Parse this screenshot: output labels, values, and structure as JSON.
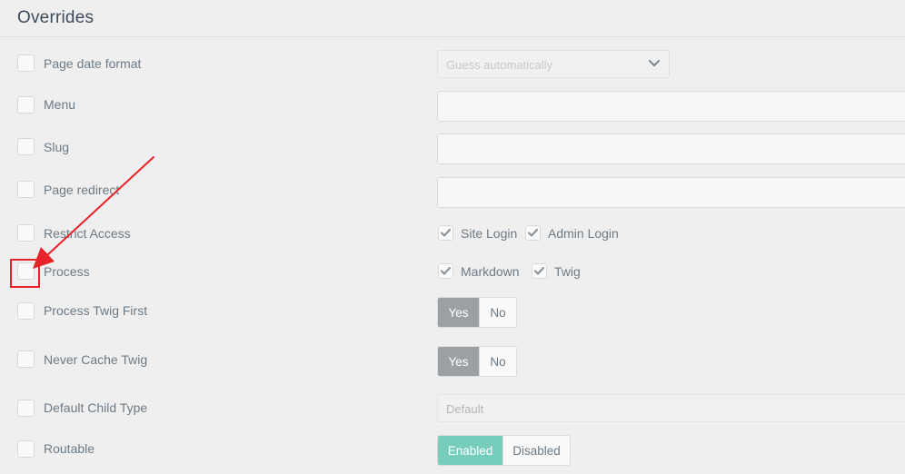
{
  "section": {
    "title": "Overrides"
  },
  "rows": {
    "page_date_format": {
      "label": "Page date format",
      "select_value": "Guess automatically"
    },
    "menu": {
      "label": "Menu",
      "value": ""
    },
    "slug": {
      "label": "Slug",
      "value": ""
    },
    "page_redirect": {
      "label": "Page redirect",
      "value": ""
    },
    "restrict_access": {
      "label": "Restrict Access",
      "options": [
        {
          "label": "Site Login",
          "checked": true
        },
        {
          "label": "Admin Login",
          "checked": true
        }
      ]
    },
    "process": {
      "label": "Process",
      "options": [
        {
          "label": "Markdown",
          "checked": true
        },
        {
          "label": "Twig",
          "checked": true
        }
      ]
    },
    "process_twig_first": {
      "label": "Process Twig First",
      "yes": "Yes",
      "no": "No",
      "selected": "Yes"
    },
    "never_cache_twig": {
      "label": "Never Cache Twig",
      "yes": "Yes",
      "no": "No",
      "selected": "Yes"
    },
    "default_child_type": {
      "label": "Default Child Type",
      "placeholder": "Default"
    },
    "routable": {
      "label": "Routable",
      "enabled": "Enabled",
      "disabled": "Disabled",
      "selected": "Enabled"
    }
  },
  "colors": {
    "title": "#3c4b5c",
    "label": "#6c7a86",
    "toggle_selected_grey": "#9aa0a4",
    "toggle_selected_teal": "#76cdbb",
    "annotation_red": "#e8232a"
  },
  "icons": {
    "select_arrow": "chevron-down-icon",
    "check": "check-icon"
  }
}
